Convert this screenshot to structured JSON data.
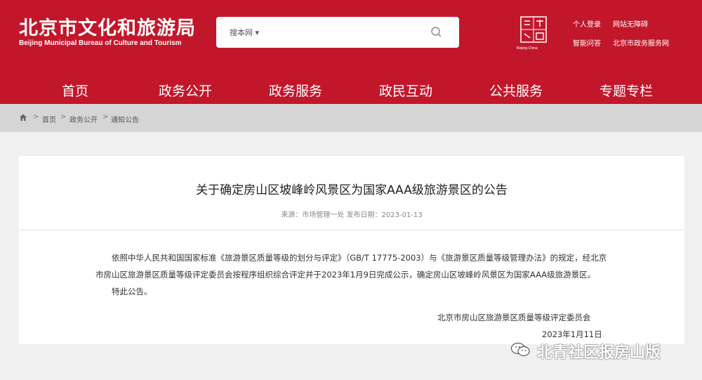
{
  "header": {
    "logo_cn": "北京市文化和旅游局",
    "logo_en": "Beijing Municipal Bureau of Culture and Tourism",
    "search_scope": "搜本网 ▾",
    "search_placeholder": "",
    "capital_logo_text": "Beijing·China",
    "links": [
      "个人登录",
      "网站无障碍",
      "智能问答",
      "北京市政务服务网"
    ]
  },
  "nav": {
    "items": [
      "首页",
      "政务公开",
      "政务服务",
      "政民互动",
      "公共服务",
      "专题专栏"
    ]
  },
  "breadcrumb": {
    "items": [
      "首页",
      "政务公开",
      "通知公告"
    ]
  },
  "article": {
    "title": "关于确定房山区坡峰岭风景区为国家AAA级旅游景区的公告",
    "meta": "来源：市场管理一处   发布日期：2023-01-13",
    "paragraph1": "依照中华人民共和国国家标准《旅游景区质量等级的划分与评定》（GB/T 17775-2003）与《旅游景区质量等级管理办法》的规定，经北京市房山区旅游景区质量等级评定委员会按程序组织综合评定并于2023年1月9日完成公示，确定房山区坡峰岭风景区为国家AAA级旅游景区。",
    "paragraph2": "特此公告。",
    "sign_org": "北京市房山区旅游景区质量等级评定委员会",
    "sign_date": "2023年1月11日"
  },
  "watermark": {
    "text": "北青社区报房山版"
  },
  "colors": {
    "brand": "#c2172b",
    "crumb_bg": "#d5d5d5",
    "page_bg": "#f1f1f1"
  }
}
